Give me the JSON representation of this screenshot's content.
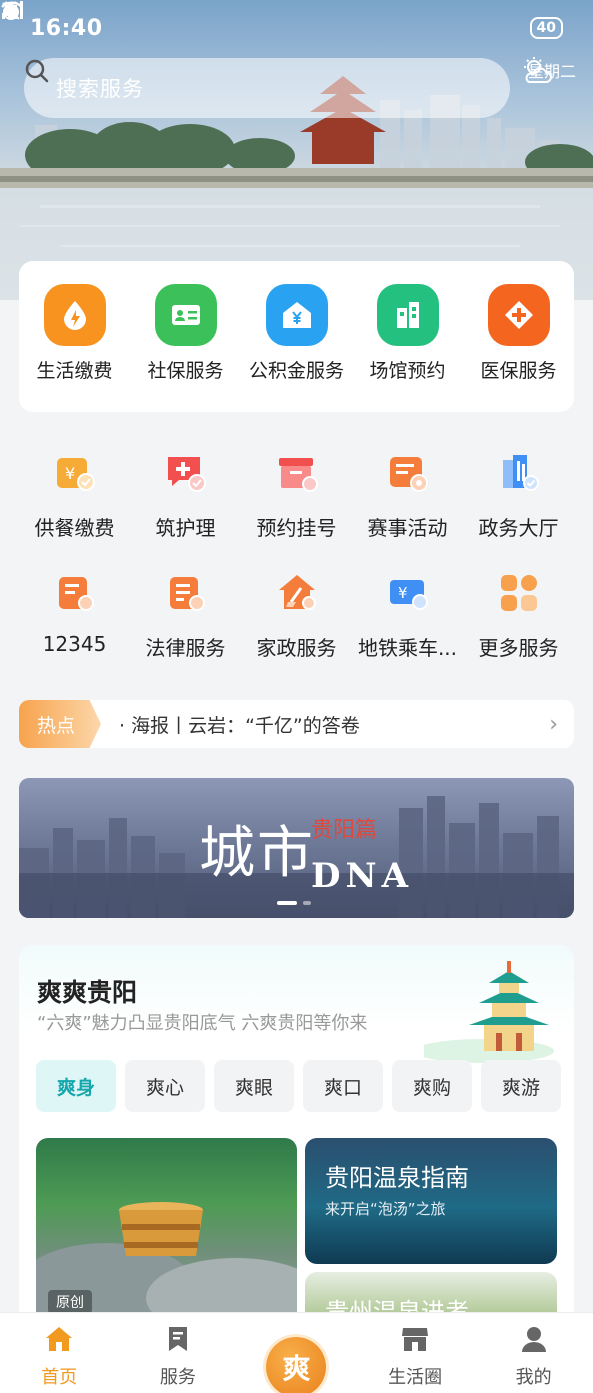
{
  "status_bar": {
    "time": "16:40",
    "battery": "40"
  },
  "search": {
    "placeholder": "搜索服务"
  },
  "weather": {
    "day": "星期二",
    "icon": "partly-cloudy-icon"
  },
  "main_services": [
    {
      "label": "生活缴费",
      "icon": "bolt-drop-icon",
      "color": "#f7931e"
    },
    {
      "label": "社保服务",
      "icon": "id-card-icon",
      "color": "#3cc15a"
    },
    {
      "label": "公积金服务",
      "icon": "house-yen-icon",
      "color": "#2aa2f2"
    },
    {
      "label": "场馆预约",
      "icon": "building-icon",
      "color": "#24c07f"
    },
    {
      "label": "医保服务",
      "icon": "medical-cross-icon",
      "color": "#f4651f"
    }
  ],
  "grid_services": [
    {
      "label": "供餐缴费",
      "icon": "meal-bill-icon",
      "color": "#f6ab36"
    },
    {
      "label": "筑护理",
      "icon": "nurse-chat-icon",
      "color": "#f24f4f"
    },
    {
      "label": "预约挂号",
      "icon": "appointment-box-icon",
      "color": "#f24f4f"
    },
    {
      "label": "赛事活动",
      "icon": "event-medal-icon",
      "color": "#f57d3b"
    },
    {
      "label": "政务大厅",
      "icon": "gov-hall-icon",
      "color": "#3f8ff5"
    },
    {
      "label": "12345",
      "icon": "hotline-doc-icon",
      "color": "#f57d3b"
    },
    {
      "label": "法律服务",
      "icon": "legal-doc-icon",
      "color": "#f57d3b"
    },
    {
      "label": "家政服务",
      "icon": "housekeeping-icon",
      "color": "#f57d3b"
    },
    {
      "label": "地铁乘车...",
      "icon": "metro-card-icon",
      "color": "#3f8ff5"
    },
    {
      "label": "更多服务",
      "icon": "more-grid-icon",
      "color": "#f7a04d"
    }
  ],
  "hot": {
    "tag": "热点",
    "text": "· 海报丨云岩：“千亿”的答卷"
  },
  "banner": {
    "title": "城市",
    "subtitle": "贵阳篇",
    "dna": "DNA"
  },
  "section": {
    "title": "爽爽贵阳",
    "subtitle": "“六爽”魅力凸显贵阳底气  六爽贵阳等你来",
    "tabs": [
      "爽身",
      "爽心",
      "爽眼",
      "爽口",
      "爽购",
      "爽游"
    ],
    "cards": {
      "big_badge": "原创",
      "card1_title": "贵阳温泉指南",
      "card1_sub": "来开启“泡汤”之旅",
      "card2_title": "贵州温泉进考"
    }
  },
  "bottom_nav": [
    {
      "label": "首页",
      "icon": "home-icon"
    },
    {
      "label": "服务",
      "icon": "bookmark-icon"
    },
    {
      "label": "",
      "icon": "center-logo-icon",
      "glyph": "爽"
    },
    {
      "label": "生活圈",
      "icon": "store-icon"
    },
    {
      "label": "我的",
      "icon": "user-icon"
    }
  ],
  "colors": {
    "accent": "#f29a1f",
    "teal": "#16a7ad"
  }
}
